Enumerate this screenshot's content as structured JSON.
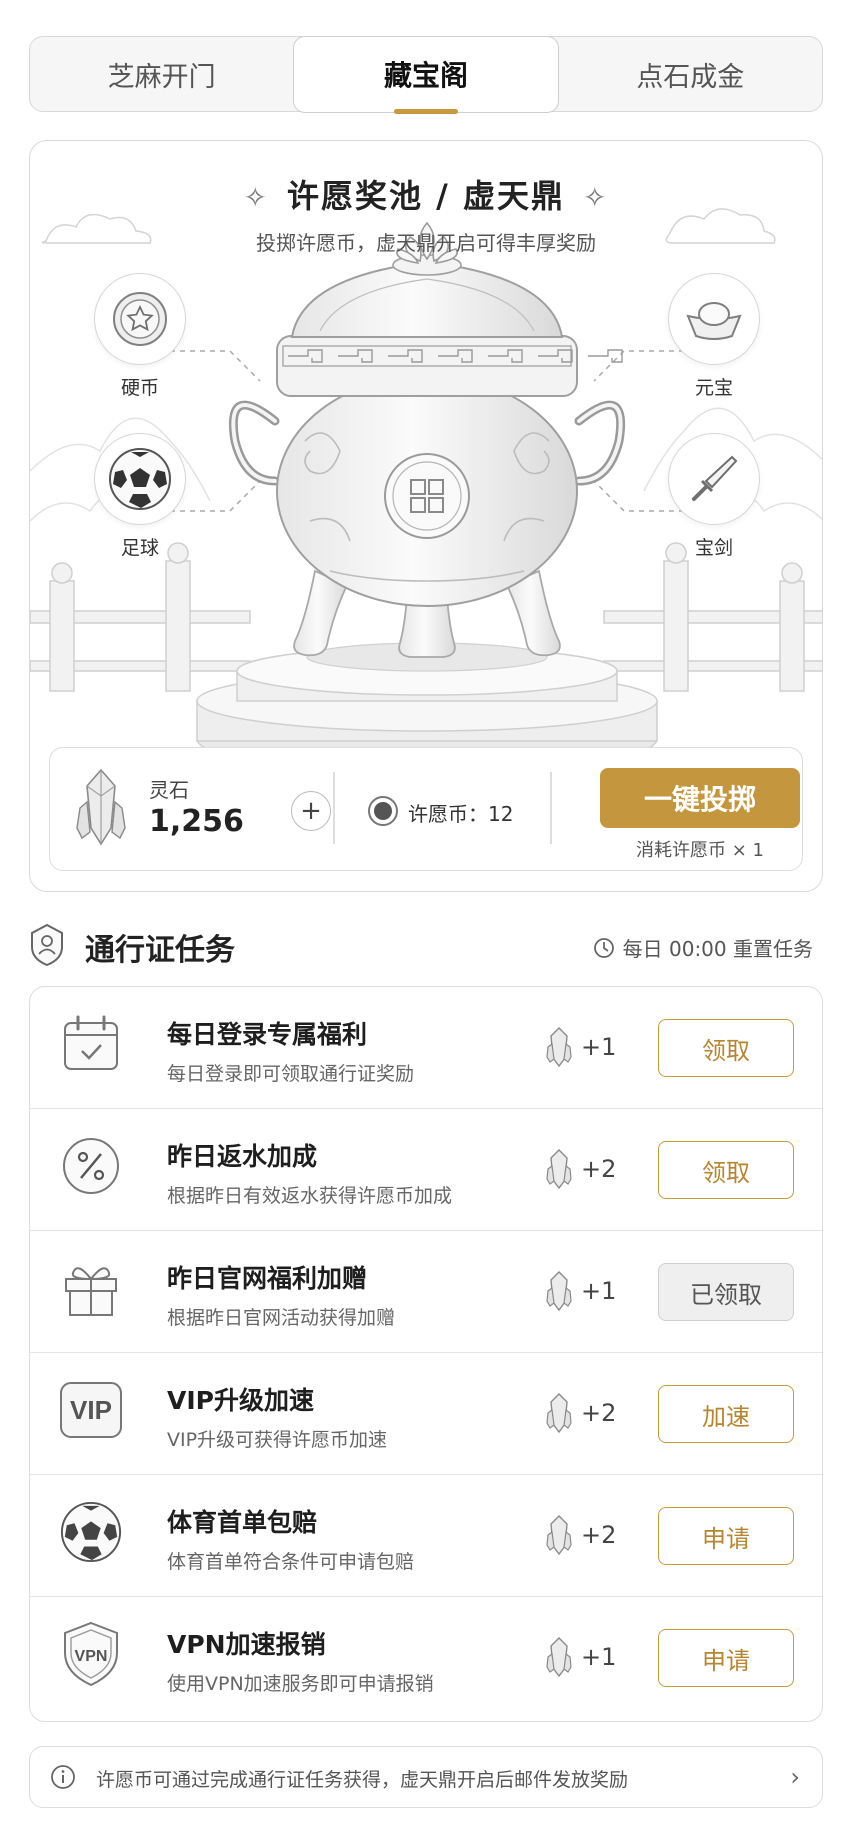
{
  "tabs": [
    {
      "label": "芝麻开门",
      "active": false
    },
    {
      "label": "藏宝阁",
      "active": true
    },
    {
      "label": "点石成金",
      "active": false
    }
  ],
  "pool": {
    "title": "许愿奖池 / 虚天鼎",
    "spark": "✧",
    "subtitle": "投掷许愿币，虚天鼎开启可得丰厚奖励",
    "prizes": {
      "coin": "硬币",
      "ingot": "元宝",
      "football": "足球",
      "sword": "宝剑"
    },
    "stone_label": "灵石",
    "stone_value": "1,256",
    "plus": "+",
    "wish_coin": "许愿币：12",
    "throw_button": "一键投掷",
    "throw_cost": "消耗许愿币 × 1"
  },
  "tasks_header": {
    "title": "通行证任务",
    "reset": "每日 00:00 重置任务"
  },
  "tasks": [
    {
      "icon": "calendar-check-icon",
      "title": "每日登录专属福利",
      "desc": "每日登录即可领取通行证奖励",
      "reward": "+1",
      "button": "领取",
      "state": "available"
    },
    {
      "icon": "percent-icon",
      "title": "昨日返水加成",
      "desc": "根据昨日有效返水获得许愿币加成",
      "reward": "+2",
      "button": "领取",
      "state": "available"
    },
    {
      "icon": "gift-icon",
      "title": "昨日官网福利加赠",
      "desc": "根据昨日官网活动获得加赠",
      "reward": "+1",
      "button": "已领取",
      "state": "claimed"
    },
    {
      "icon": "vip-icon",
      "title": "VIP升级加速",
      "desc": "VIP升级可获得许愿币加速",
      "reward": "+2",
      "button": "加速",
      "state": "available"
    },
    {
      "icon": "football-icon",
      "title": "体育首单包赔",
      "desc": "体育首单符合条件可申请包赔",
      "reward": "+2",
      "button": "申请",
      "state": "available"
    },
    {
      "icon": "vpn-shield-icon",
      "title": "VPN加速报销",
      "desc": "使用VPN加速服务即可申请报销",
      "reward": "+1",
      "button": "申请",
      "state": "available"
    }
  ],
  "notice": {
    "text": "许愿币可通过完成通行证任务获得，虚天鼎开启后邮件发放奖励",
    "chevron": "›"
  },
  "colors": {
    "accent": "#c4973e",
    "border": "#dddddd",
    "muted": "#666666"
  }
}
